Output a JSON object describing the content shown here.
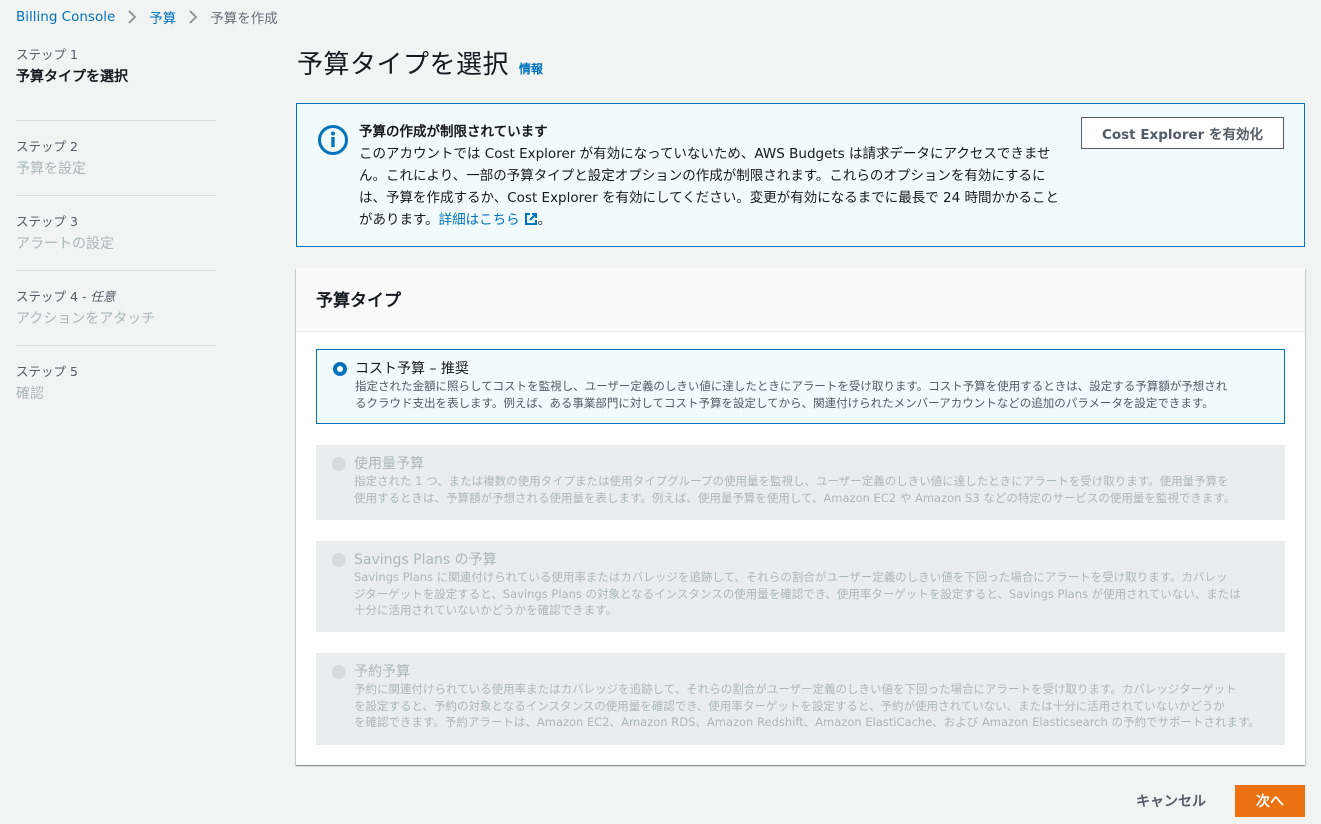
{
  "breadcrumb": {
    "items": [
      "Billing Console",
      "予算",
      "予算を作成"
    ]
  },
  "steps": [
    {
      "number": "ステップ 1",
      "label": "予算タイプを選択"
    },
    {
      "number": "ステップ 2",
      "label": "予算を設定"
    },
    {
      "number": "ステップ 3",
      "label": "アラートの設定"
    },
    {
      "number": "ステップ 4 - ",
      "optional": "任意",
      "label": "アクションをアタッチ"
    },
    {
      "number": "ステップ 5",
      "label": "確認"
    }
  ],
  "page": {
    "title": "予算タイプを選択",
    "info_link": "情報"
  },
  "alert": {
    "title": "予算の作成が制限されています",
    "line1": "このアカウントでは Cost Explorer が有効になっていないため、AWS Budgets は請求データにアクセスできませ",
    "line2": "ん。これにより、一部の予算タイプと設定オプションの作成が制限されます。これらのオプションを有効にするに",
    "line3": "は、予算を作成するか、Cost Explorer を有効にしてください。変更が有効になるまでに最長で 24 時間かかること",
    "line4_prefix": "があります。",
    "link": "詳細はこちら",
    "line4_suffix": "。",
    "button": "Cost Explorer を有効化"
  },
  "budget_type": {
    "heading": "予算タイプ",
    "options": [
      {
        "title": "コスト予算 – 推奨",
        "desc1": "指定された金額に照らしてコストを監視し、ユーザー定義のしきい値に達したときにアラートを受け取ります。コスト予算を使用するときは、設定する予算額が予想され",
        "desc2": "るクラウド支出を表します。例えば、ある事業部門に対してコスト予算を設定してから、関連付けられたメンバーアカウントなどの追加のパラメータを設定できます。",
        "desc3": "",
        "state": "selected"
      },
      {
        "title": "使用量予算",
        "desc1": "指定された 1 つ、または複数の使用タイプまたは使用タイプグループの使用量を監視し、ユーザー定義のしきい値に達したときにアラートを受け取ります。使用量予算を",
        "desc2": "使用するときは、予算額が予想される使用量を表します。例えば、使用量予算を使用して、Amazon EC2 や Amazon S3 などの特定のサービスの使用量を監視できます。",
        "desc3": "",
        "state": "disabled"
      },
      {
        "title": "Savings Plans の予算",
        "desc1": "Savings Plans に関連付けられている使用率またはカバレッジを追跡して、それらの割合がユーザー定義のしきい値を下回った場合にアラートを受け取ります。カバレッ",
        "desc2": "ジターゲットを設定すると、Savings Plans の対象となるインスタンスの使用量を確認でき、使用率ターゲットを設定すると、Savings Plans が使用されていない、または",
        "desc3": "十分に活用されていないかどうかを確認できます。",
        "state": "disabled"
      },
      {
        "title": "予約予算",
        "desc1": "予約に関連付けられている使用率またはカバレッジを追跡して、それらの割合がユーザー定義のしきい値を下回った場合にアラートを受け取ります。カバレッジターゲット",
        "desc2": "を設定すると、予約の対象となるインスタンスの使用量を確認でき、使用率ターゲットを設定すると、予約が使用されていない、または十分に活用されていないかどうか",
        "desc3": "を確認できます。予約アラートは、Amazon EC2、Amazon RDS、Amazon Redshift、Amazon ElastiCache、および Amazon Elasticsearch の予約でサポートされます。",
        "state": "disabled"
      }
    ]
  },
  "footer": {
    "cancel": "キャンセル",
    "next": "次へ"
  },
  "colors": {
    "link": "#0073bb",
    "primary_button": "#ec7211",
    "info_bg": "#f1faff"
  }
}
